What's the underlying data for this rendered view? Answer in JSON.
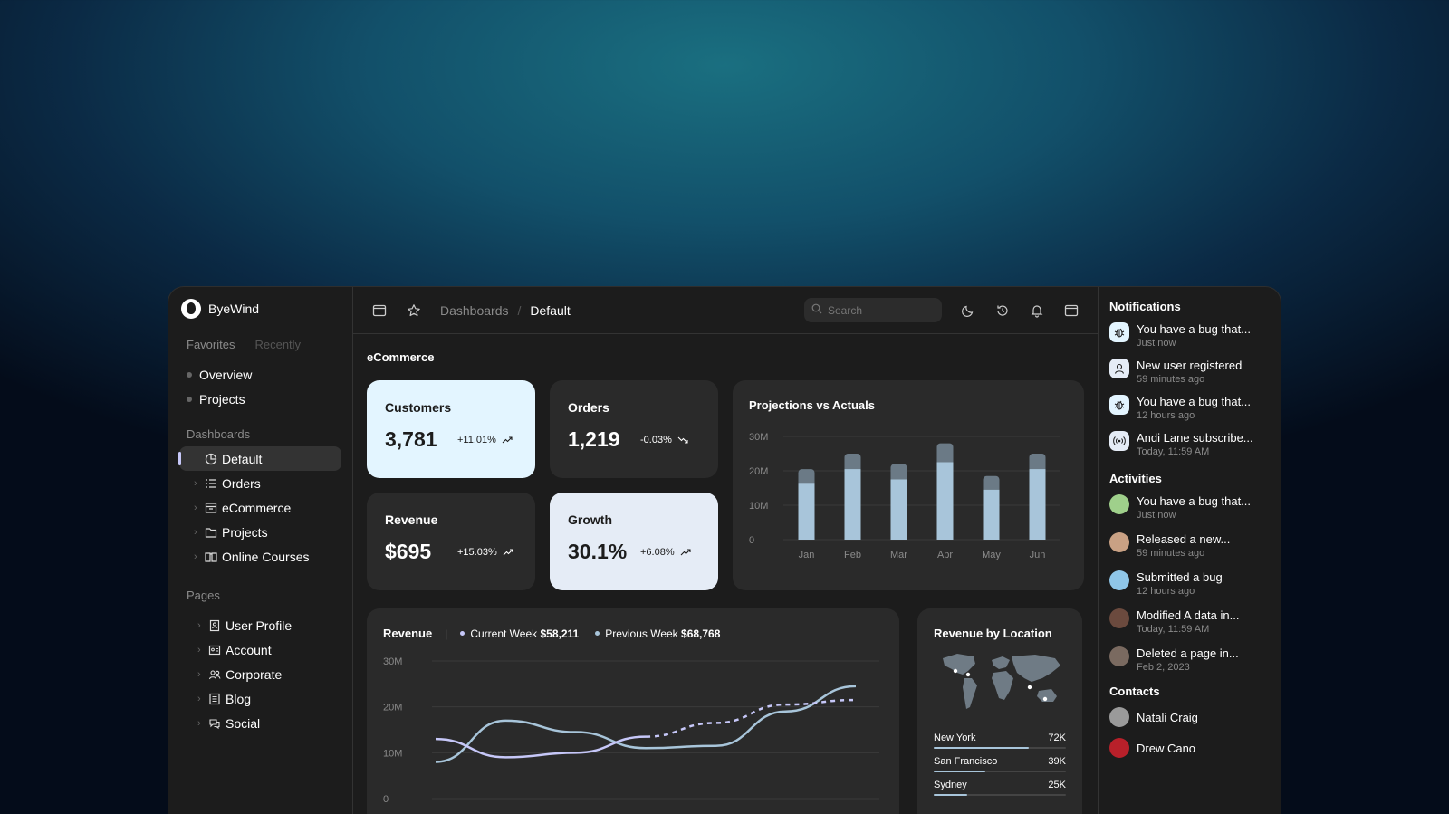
{
  "brand": {
    "name": "ByeWind"
  },
  "sidebar": {
    "tabs": [
      "Favorites",
      "Recently"
    ],
    "favorites": [
      {
        "label": "Overview"
      },
      {
        "label": "Projects"
      }
    ],
    "dashboards_label": "Dashboards",
    "dashboards": [
      {
        "label": "Default",
        "icon": "pie-chart-icon",
        "active": true
      },
      {
        "label": "Orders",
        "icon": "list-icon"
      },
      {
        "label": "eCommerce",
        "icon": "storefront-icon"
      },
      {
        "label": "Projects",
        "icon": "folder-icon"
      },
      {
        "label": "Online Courses",
        "icon": "book-icon"
      }
    ],
    "pages_label": "Pages",
    "pages": [
      {
        "label": "User Profile",
        "icon": "id-card-icon"
      },
      {
        "label": "Account",
        "icon": "id-badge-icon"
      },
      {
        "label": "Corporate",
        "icon": "users-icon"
      },
      {
        "label": "Blog",
        "icon": "notebook-icon"
      },
      {
        "label": "Social",
        "icon": "chat-icon"
      }
    ]
  },
  "topbar": {
    "breadcrumb": [
      "Dashboards",
      "Default"
    ],
    "search_placeholder": "Search"
  },
  "main": {
    "title": "eCommerce",
    "kpis": [
      {
        "label": "Customers",
        "value": "3,781",
        "change": "+11.01%",
        "trend": "up"
      },
      {
        "label": "Orders",
        "value": "1,219",
        "change": "-0.03%",
        "trend": "down"
      },
      {
        "label": "Revenue",
        "value": "$695",
        "change": "+15.03%",
        "trend": "up"
      },
      {
        "label": "Growth",
        "value": "30.1%",
        "change": "+6.08%",
        "trend": "up"
      }
    ],
    "revenue": {
      "title": "Revenue",
      "current_label": "Current Week",
      "current_value": "$58,211",
      "previous_label": "Previous Week",
      "previous_value": "$68,768"
    },
    "location": {
      "title": "Revenue by Location",
      "rows": [
        {
          "city": "New York",
          "value": "72K",
          "fraction": 0.72
        },
        {
          "city": "San Francisco",
          "value": "39K",
          "fraction": 0.39
        },
        {
          "city": "Sydney",
          "value": "25K",
          "fraction": 0.25
        }
      ]
    }
  },
  "chart_data": [
    {
      "type": "bar",
      "title": "Projections vs Actuals",
      "categories": [
        "Jan",
        "Feb",
        "Mar",
        "Apr",
        "May",
        "Jun"
      ],
      "yticks": [
        "30M",
        "20M",
        "10M",
        "0"
      ],
      "ylim": [
        0,
        30
      ],
      "series": [
        {
          "values": [
            16.5,
            20.5,
            17.5,
            22.5,
            14.5,
            20.5
          ]
        },
        {
          "values": [
            20.5,
            25,
            22,
            28,
            18.5,
            25
          ]
        }
      ]
    },
    {
      "type": "line",
      "title": "Revenue",
      "x": [
        0,
        1,
        2,
        3,
        4,
        5,
        6
      ],
      "yticks": [
        "30M",
        "20M",
        "10M",
        "0"
      ],
      "ylim": [
        0,
        30
      ],
      "series": [
        {
          "name": "Current Week",
          "values": [
            13,
            9,
            10,
            13.5,
            16.5,
            20.5,
            21.5
          ]
        },
        {
          "name": "Previous Week",
          "values": [
            8,
            17,
            14.5,
            11,
            11.5,
            19,
            24.5
          ]
        }
      ]
    }
  ],
  "notifications": {
    "title": "Notifications",
    "items": [
      {
        "text": "You have a bug that...",
        "time": "Just now",
        "icon": "bug-icon"
      },
      {
        "text": "New user registered",
        "time": "59 minutes ago",
        "icon": "user-icon"
      },
      {
        "text": "You have a bug that...",
        "time": "12 hours ago",
        "icon": "bug-icon"
      },
      {
        "text": "Andi Lane subscribe...",
        "time": "Today, 11:59 AM",
        "icon": "broadcast-icon"
      }
    ]
  },
  "activities": {
    "title": "Activities",
    "items": [
      {
        "text": "You have a bug that...",
        "time": "Just now",
        "color": "#9fd08b"
      },
      {
        "text": "Released a new...",
        "time": "59 minutes ago",
        "color": "#c9a184"
      },
      {
        "text": "Submitted a bug",
        "time": "12 hours ago",
        "color": "#8fc6e8"
      },
      {
        "text": "Modified A data in...",
        "time": "Today, 11:59 AM",
        "color": "#6b4a3e"
      },
      {
        "text": "Deleted a page in...",
        "time": "Feb 2, 2023",
        "color": "#7a6a60"
      }
    ]
  },
  "contacts": {
    "title": "Contacts",
    "items": [
      {
        "name": "Natali Craig",
        "color": "#9a9a9a"
      },
      {
        "name": "Drew Cano",
        "color": "#b8202a"
      }
    ]
  }
}
